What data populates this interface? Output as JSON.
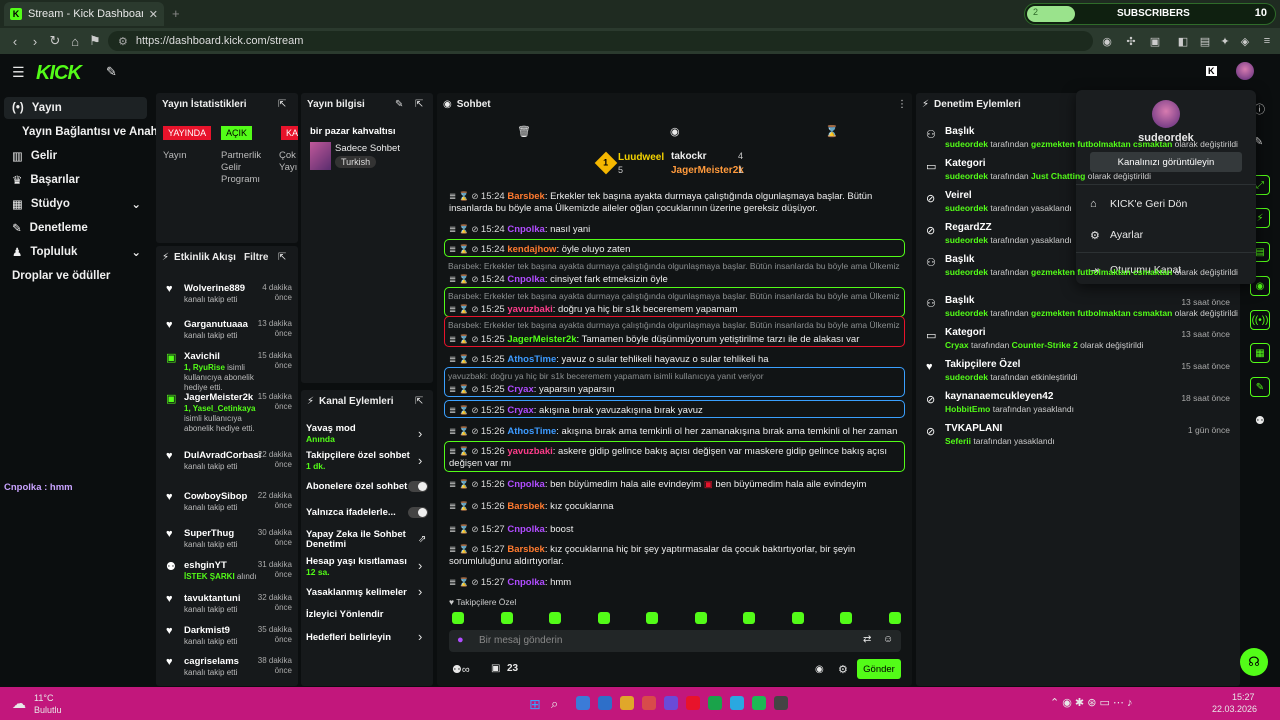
{
  "browser": {
    "tab_title": "Stream - Kick Dashboard",
    "url": "https://dashboard.kick.com/stream",
    "subscribers_label": "SUBSCRIBERS",
    "subscribers_count": "10",
    "subscribers_progress": "2"
  },
  "nav": {
    "items": [
      "Yayın",
      "Yayın Bağlantısı ve Anahtarı",
      "Gelir",
      "Başarılar",
      "Stüdyo",
      "Denetleme",
      "Topluluk",
      "Droplar ve ödüller"
    ]
  },
  "stats": {
    "title": "Yayın İstatistikleri",
    "badge_live": "YAYINDA",
    "badge_on": "AÇIK",
    "badge_off": "KAPA",
    "label_stream": "Yayın",
    "label_partner": "Partnerlik Gelir Programı",
    "label_cut": "Çok Yayı"
  },
  "info": {
    "title": "Yayın bilgisi",
    "stream_title": "bir pazar kahvaltısı",
    "category": "Sadece Sohbet",
    "language": "Turkish"
  },
  "activity": {
    "title": "Etkinlik Akışı",
    "filter": "Filtre",
    "items": [
      {
        "name": "Wolverine889",
        "time": "4 dakika önce",
        "sub": "kanalı takip etti",
        "kind": "follow"
      },
      {
        "name": "Garganutuaaa",
        "time": "13 dakika önce",
        "sub": "kanalı takip etti",
        "kind": "follow"
      },
      {
        "name": "Xavichil",
        "time": "15 dakika önce",
        "sub_g": "1, RyuRise",
        "sub": "isimli kullanıcıya abonelik hediye etti.",
        "kind": "gift"
      },
      {
        "name": "JagerMeister2k",
        "time": "15 dakika önce",
        "sub_g": "1, Yasel_Cetinkaya",
        "sub": "isimli kullanıcıya abonelik hediye etti.",
        "kind": "gift"
      },
      {
        "name": "DulAvradCorbasi",
        "time": "22 dakika önce",
        "sub": "kanalı takip etti",
        "kind": "follow"
      },
      {
        "name": "CowboySibop",
        "time": "22 dakika önce",
        "sub": "kanalı takip etti",
        "kind": "follow"
      },
      {
        "name": "SuperThug",
        "time": "30 dakika önce",
        "sub": "kanalı takip etti",
        "kind": "follow"
      },
      {
        "name": "eshginYT",
        "time": "31 dakika önce",
        "sub_g": "İSTEK ŞARKI",
        "sub": "alındı",
        "kind": "song"
      },
      {
        "name": "tavuktantuni",
        "time": "32 dakika önce",
        "sub": "kanalı takip etti",
        "kind": "follow"
      },
      {
        "name": "Darkmist9",
        "time": "35 dakika önce",
        "sub": "kanalı takip etti",
        "kind": "follow"
      },
      {
        "name": "cagriselams",
        "time": "38 dakika önce",
        "sub": "kanalı takip etti",
        "kind": "follow"
      }
    ]
  },
  "actions": {
    "title": "Kanal Eylemleri",
    "slow": "Yavaş mod",
    "slow_sub": "Anında",
    "followers": "Takipçilere özel sohbet",
    "followers_sub": "1 dk.",
    "subs": "Abonelere özel sohbet",
    "emotes": "Yalnızca ifadelerle...",
    "ai": "Yapay Zeka ile Sohbet Denetimi",
    "age": "Hesap yaşı kısıtlaması",
    "age_sub": "12 sa.",
    "banned": "Yasaklanmış kelimeler",
    "redirect": "İzleyici Yönlendir",
    "goals": "Hedefleri belirleyin"
  },
  "chat": {
    "title": "Sohbet",
    "leaders": {
      "first": "Luudweel",
      "first_count": "5",
      "second": "takockr",
      "second_count": "4",
      "third": "JagerMeister2k",
      "third_count": "1"
    },
    "lines": [
      {
        "ts": "15:24",
        "user": "Barsbek",
        "color": "#ff7a2f",
        "text": "Erkekler tek başına ayakta durmaya çalıştığında olgunlaşmaya başlar. Bütün insanlarda bu böyle ama Ülkemizde aileler oğlan çocuklarının üzerine gereksiz düşüyor."
      },
      {
        "ts": "15:24",
        "user": "Cnpolka",
        "color": "#b04cff",
        "text": "nasıl yani"
      },
      {
        "ts": "15:24",
        "user": "kendajhow",
        "color": "#ff7a2f",
        "text": "öyle oluyo zaten"
      },
      {
        "reply": "Barsbek: Erkekler tek başına ayakta durmaya çalıştığında olgunlaşmaya başlar. Bütün insanlarda bu böyle ama Ülkemizde aileler oğlan..."
      },
      {
        "ts": "15:24",
        "user": "Cnpolka",
        "color": "#b04cff",
        "text": "cinsiyet fark etmeksizin öyle"
      },
      {
        "reply": "Barsbek: Erkekler tek başına ayakta durmaya çalıştığında olgunlaşmaya başlar. Bütün insanlarda bu böyle ama Ülkemizde aileler oğlan..."
      },
      {
        "ts": "15:25",
        "user": "yavuzbaki",
        "color": "#ff3d8b",
        "text": "doğru ya hiç bir s1k beceremem yapamam"
      },
      {
        "reply": "Barsbek: Erkekler tek başına ayakta durmaya çalıştığında olgunlaşmaya başlar. Bütün insanlarda bu böyle ama Ülkemizde aileler oğlan..."
      },
      {
        "ts": "15:25",
        "user": "JagerMeister2k",
        "color": "#53fc18",
        "text": "Tamamen böyle düşünmüyorum yetiştirilme tarzı ile de alakası var"
      },
      {
        "ts": "15:25",
        "user": "AthosTime",
        "color": "#3d9bff",
        "text": "yavuz o sular tehlikeli hayavuz o sular tehlikeli ha"
      },
      {
        "reply": "yavuzbaki: doğru ya hiç bir s1k beceremem yapamam isimli kullanıcıya yanıt veriyor"
      },
      {
        "ts": "15:25",
        "user": "Cryax",
        "color": "#b04cff",
        "text": "yaparsın yaparsın"
      },
      {
        "ts": "15:25",
        "user": "Cryax",
        "color": "#b04cff",
        "text": "akışına bırak yavuzakışına bırak yavuz"
      },
      {
        "ts": "15:26",
        "user": "AthosTime",
        "color": "#3d9bff",
        "text": "akışına bırak ama temkinli ol her zamanakışına bırak ama temkinli ol her zaman"
      },
      {
        "ts": "15:26",
        "user": "yavuzbaki",
        "color": "#ff3d8b",
        "text": "askere gidip gelince bakış açısı değişen var mıaskere gidip gelince bakış açısı değişen var mı"
      },
      {
        "ts": "15:26",
        "user": "Cnpolka",
        "color": "#b04cff",
        "text": "ben büyümedim hala aile evindeyim",
        "text2": "ben büyümedim hala aile evindeyim"
      },
      {
        "ts": "15:26",
        "user": "Barsbek",
        "color": "#ff7a2f",
        "text": "kız çocuklarına"
      },
      {
        "ts": "15:27",
        "user": "Cnpolka",
        "color": "#b04cff",
        "text": "boost"
      },
      {
        "ts": "15:27",
        "user": "Barsbek",
        "color": "#ff7a2f",
        "text": "kız çocuklarına hiç bir şey yaptırmasalar da çocuk baktırtıyorlar, bir şeyin sorumluluğunu aldırtıyorlar."
      },
      {
        "ts": "15:27",
        "user": "Cnpolka",
        "color": "#b04cff",
        "text": "hmm"
      }
    ],
    "followers_only": "Takipçilere Özel",
    "input_placeholder": "Bir mesaj gönderin",
    "viewer_count": "23",
    "send": "Gönder"
  },
  "moderation": {
    "title": "Denetim Eylemleri",
    "items": [
      {
        "title": "Başlık",
        "user": "sudeordek",
        "mid": "tarafından",
        "target": "gezmekten futbolmaktan csmaktan",
        "end": "olarak değiştirildi",
        "time": "",
        "icon": "person"
      },
      {
        "title": "Kategori",
        "user": "sudeordek",
        "mid": "tarafından",
        "target": "Just Chatting",
        "end": "olarak değiştirildi",
        "time": "",
        "icon": "category"
      },
      {
        "title": "Veirel",
        "user": "sudeordek",
        "mid": "tarafından yasaklandı",
        "target": "",
        "end": "",
        "time": "",
        "icon": "ban"
      },
      {
        "title": "RegardZZ",
        "user": "sudeordek",
        "mid": "tarafından yasaklandı",
        "target": "",
        "end": "",
        "time": "",
        "icon": "ban"
      },
      {
        "title": "Başlık",
        "user": "sudeordek",
        "mid": "tarafından",
        "target": "gezmekten futbolmaktan csmaktan",
        "end": "olarak değiştirildi",
        "time": "",
        "icon": "person"
      },
      {
        "title": "Başlık",
        "user": "sudeordek",
        "mid": "tarafından",
        "target": "gezmekten futbolmaktan csmaktan",
        "end": "olarak değiştirildi",
        "time": "13 saat önce",
        "icon": "person"
      },
      {
        "title": "Kategori",
        "user": "Cryax",
        "mid": "tarafından",
        "target": "Counter-Strike 2",
        "end": "olarak değiştirildi",
        "time": "13 saat önce",
        "icon": "category"
      },
      {
        "title": "Takipçilere Özel",
        "user": "sudeordek",
        "mid": "tarafından etkinleştirildi",
        "target": "",
        "end": "",
        "time": "15 saat önce",
        "icon": "heart"
      },
      {
        "title": "kaynanaemcukleyen42",
        "user": "HobbitEmo",
        "mid": "tarafından yasaklandı",
        "target": "",
        "end": "",
        "time": "18 saat önce",
        "icon": "ban"
      },
      {
        "title": "TVKAPLANI",
        "user": "Seferii",
        "mid": "tarafından yasaklandı",
        "target": "",
        "end": "",
        "time": "1 gün önce",
        "icon": "ban"
      }
    ]
  },
  "dropdown": {
    "username": "sudeordek",
    "view_channel": "Kanalınızı görüntüleyin",
    "back": "KICK'e Geri Dön",
    "settings": "Ayarlar",
    "logout": "Oturumu Kapat"
  },
  "ghost_chat": "Cnpolka : hmm",
  "taskbar": {
    "weather": "11°C",
    "weather_sub": "Bulutlu",
    "time": "15:27",
    "date": "22.03.2026"
  },
  "colors": {
    "accent": "#53fc18",
    "taskbar": "#c2177c",
    "live": "#e8132b"
  }
}
